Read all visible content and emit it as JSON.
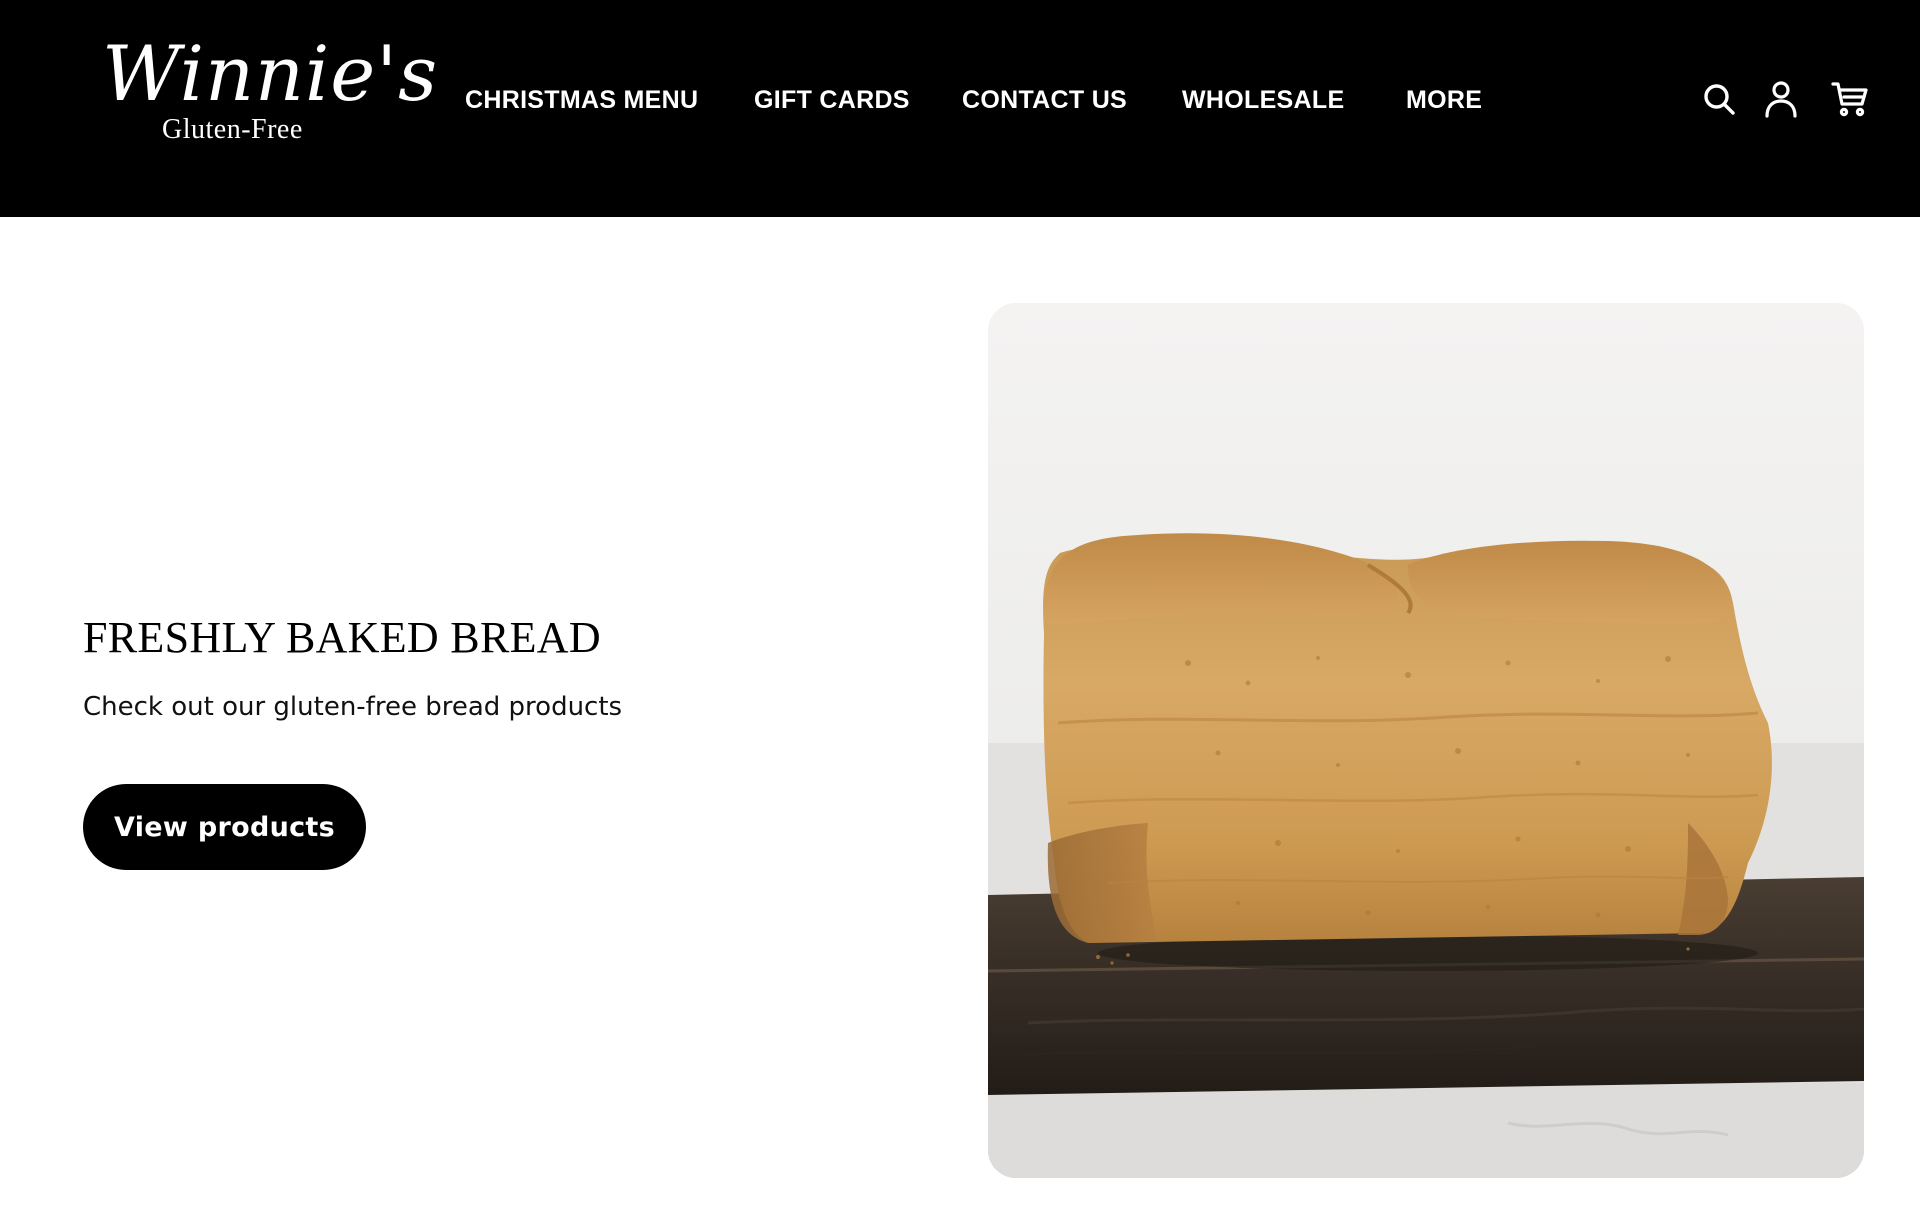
{
  "brand": {
    "logo_script": "Winnie's",
    "logo_sub": "Gluten-Free"
  },
  "nav": {
    "items": [
      {
        "label": "CHRISTMAS MENU"
      },
      {
        "label": "GIFT CARDS"
      },
      {
        "label": "CONTACT US"
      },
      {
        "label": "WHOLESALE"
      },
      {
        "label": "MORE"
      }
    ]
  },
  "header_icons": [
    "search-icon",
    "account-icon",
    "cart-icon"
  ],
  "hero": {
    "title": "FRESHLY BAKED BREAD",
    "subtitle": "Check out our gluten-free bread products",
    "button_label": "View products"
  },
  "colors": {
    "header_bg": "#000000",
    "header_text": "#ffffff",
    "page_bg": "#ffffff",
    "button_bg": "#000000",
    "button_text": "#ffffff"
  }
}
